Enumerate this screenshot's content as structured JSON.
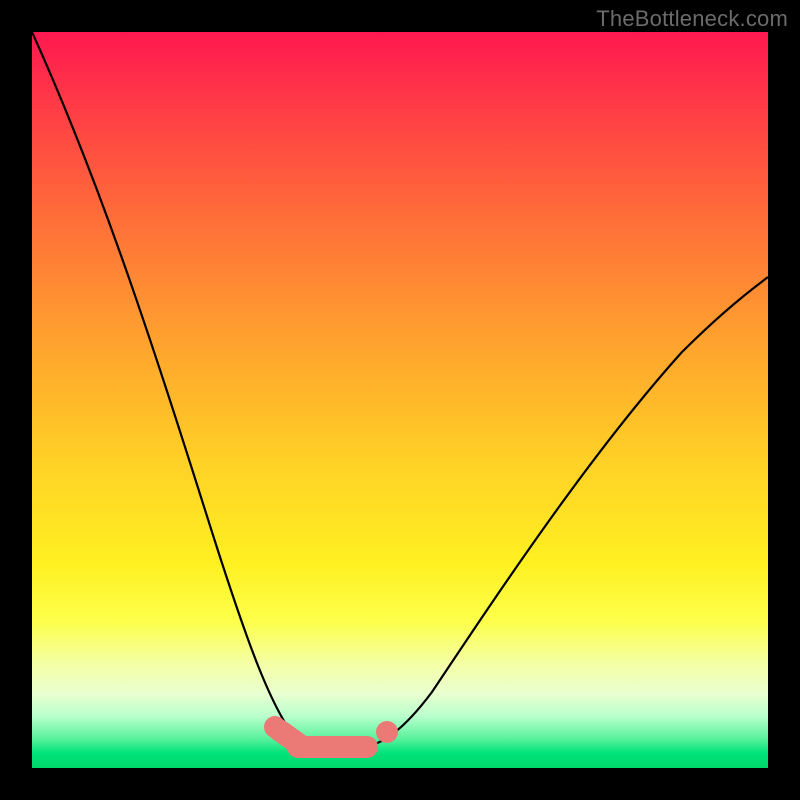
{
  "watermark": "TheBottleneck.com",
  "chart_data": {
    "type": "line",
    "title": "",
    "xlabel": "",
    "ylabel": "",
    "series": [
      {
        "name": "left-curve",
        "x": [
          0.0,
          0.05,
          0.12,
          0.19,
          0.26,
          0.33,
          0.37,
          0.4
        ],
        "y": [
          1.0,
          0.79,
          0.51,
          0.27,
          0.1,
          0.035,
          0.03,
          0.03
        ]
      },
      {
        "name": "right-curve",
        "x": [
          0.45,
          0.5,
          0.58,
          0.68,
          0.8,
          0.92,
          1.0
        ],
        "y": [
          0.03,
          0.045,
          0.12,
          0.26,
          0.42,
          0.56,
          0.66
        ]
      }
    ],
    "markers": [
      {
        "name": "dot-left-upper",
        "x": 0.33,
        "y": 0.05
      },
      {
        "name": "dot-left-lower",
        "x": 0.345,
        "y": 0.04
      },
      {
        "name": "dot-right",
        "x": 0.483,
        "y": 0.045
      }
    ],
    "flat_segment": {
      "x0": 0.36,
      "x1": 0.455,
      "y": 0.03
    },
    "left_diag_segment": {
      "x0": 0.335,
      "y0": 0.048,
      "x1": 0.362,
      "y1": 0.03
    },
    "xlim": [
      0,
      1
    ],
    "ylim": [
      0,
      1
    ],
    "colors": {
      "curve": "#000000",
      "marker": "#eb7a77",
      "frame": "#000000",
      "gradient_top": "#ff1850",
      "gradient_bottom": "#00d86b"
    }
  }
}
